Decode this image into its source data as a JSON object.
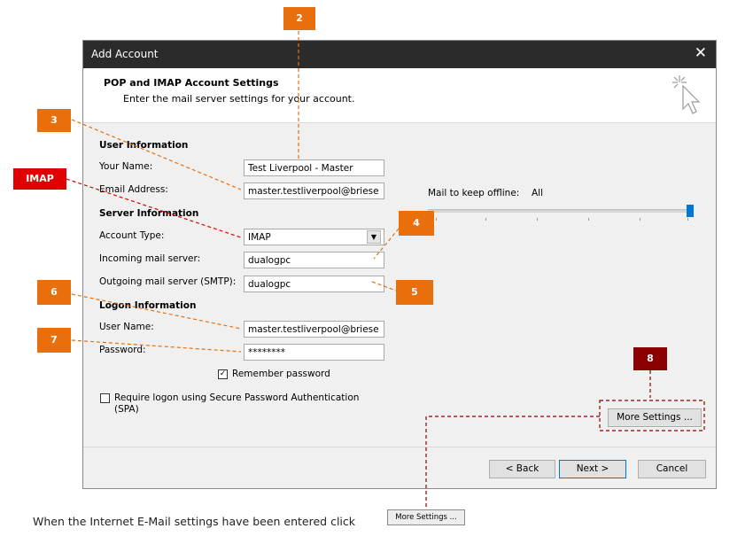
{
  "dialog": {
    "title": "Add Account",
    "close_glyph": "✕",
    "header_title": "POP and IMAP Account Settings",
    "header_subtitle": "Enter the mail server settings for your account.",
    "user_info_heading": "User Information",
    "your_name_label": "Your Name:",
    "your_name_value": "Test Liverpool - Master",
    "email_label": "Email Address:",
    "email_value": "master.testliverpool@briese",
    "server_info_heading": "Server Information",
    "account_type_label": "Account Type:",
    "account_type_value": "IMAP",
    "incoming_label": "Incoming mail server:",
    "incoming_value": "dualogpc",
    "outgoing_label": "Outgoing mail server (SMTP):",
    "outgoing_value": "dualogpc",
    "logon_heading": "Logon Information",
    "username_label": "User Name:",
    "username_value": "master.testliverpool@briese",
    "password_label": "Password:",
    "password_value": "********",
    "remember_label": "Remember password",
    "remember_checked": true,
    "spa_label_line1": "Require logon using Secure Password Authentication",
    "spa_label_line2": "(SPA)",
    "spa_checked": false,
    "offline_label": "Mail to keep offline:",
    "offline_value": "All",
    "offline_level": 1.0,
    "more_settings_label": "More Settings ...",
    "back_label": "< Back",
    "next_label": "Next >",
    "cancel_label": "Cancel"
  },
  "callouts": {
    "c2": "2",
    "c3": "3",
    "imap": "IMAP",
    "c4": "4",
    "c5": "5",
    "c6": "6",
    "c7": "7",
    "c8": "8"
  },
  "caption": {
    "text": "When the Internet E-Mail settings have been entered click",
    "button_label": "More Settings ..."
  },
  "colors": {
    "callout_orange": "#e86f0c",
    "callout_red": "#e00000",
    "callout_dark_red": "#8b0000",
    "accent_blue": "#0078d7",
    "titlebar": "#2b2b2b"
  }
}
